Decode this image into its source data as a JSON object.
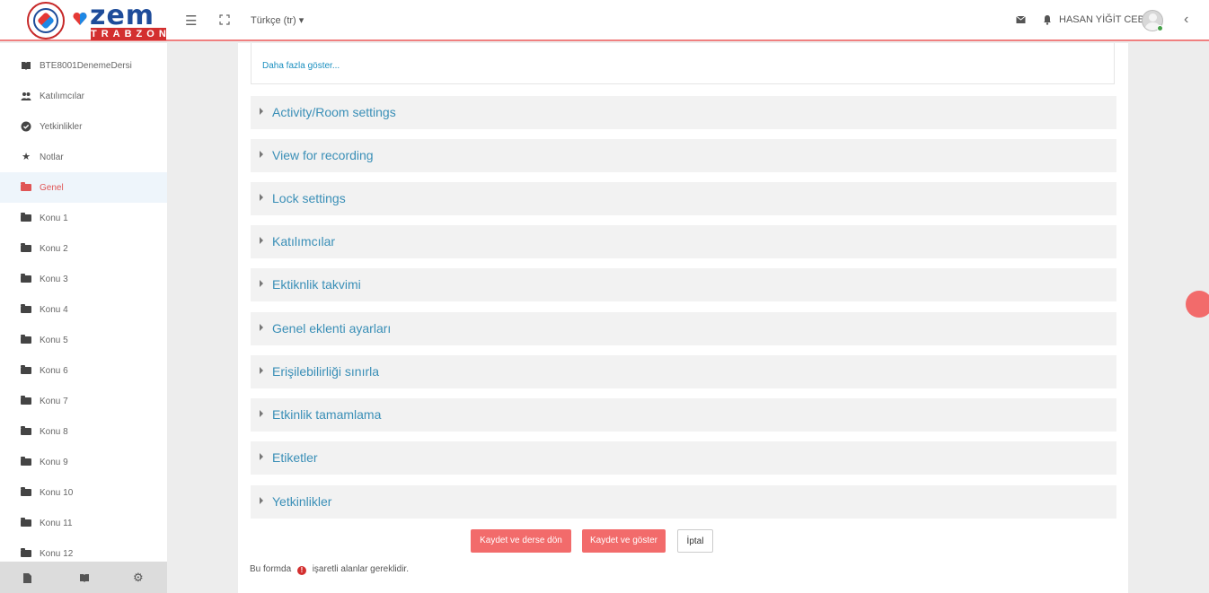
{
  "header": {
    "logo_word": "zem",
    "logo_sub": "TRABZON",
    "language": "Türkçe (tr) ▾",
    "user_name": "HASAN YİĞİT CEBECİ"
  },
  "sidebar": {
    "items": [
      {
        "label": "BTE8001DenemeDersi",
        "icon": "course-icon"
      },
      {
        "label": "Katılımcılar",
        "icon": "users-icon"
      },
      {
        "label": "Yetkinlikler",
        "icon": "check-circle-icon"
      },
      {
        "label": "Notlar",
        "icon": "star-icon"
      },
      {
        "label": "Genel",
        "icon": "folder-icon"
      },
      {
        "label": "Konu 1",
        "icon": "folder-icon"
      },
      {
        "label": "Konu 2",
        "icon": "folder-icon"
      },
      {
        "label": "Konu 3",
        "icon": "folder-icon"
      },
      {
        "label": "Konu 4",
        "icon": "folder-icon"
      },
      {
        "label": "Konu 5",
        "icon": "folder-icon"
      },
      {
        "label": "Konu 6",
        "icon": "folder-icon"
      },
      {
        "label": "Konu 7",
        "icon": "folder-icon"
      },
      {
        "label": "Konu 8",
        "icon": "folder-icon"
      },
      {
        "label": "Konu 9",
        "icon": "folder-icon"
      },
      {
        "label": "Konu 10",
        "icon": "folder-icon"
      },
      {
        "label": "Konu 11",
        "icon": "folder-icon"
      },
      {
        "label": "Konu 12",
        "icon": "folder-icon"
      }
    ],
    "active_label": "Genel"
  },
  "main": {
    "show_more": "Daha fazla göster...",
    "sections": [
      "Activity/Room settings",
      "View for recording",
      "Lock settings",
      "Katılımcılar",
      "Ektiknlik takvimi",
      "Genel eklenti ayarları",
      "Erişilebilirliği sınırla",
      "Etkinlik tamamlama",
      "Etiketler",
      "Yetkinlikler"
    ],
    "buttons": {
      "save_return": "Kaydet ve derse dön",
      "save_display": "Kaydet ve göster",
      "cancel": "İptal"
    },
    "required_note_prefix": "Bu formda",
    "required_note_suffix": "işaretli alanlar gereklidir."
  },
  "colors": {
    "accent": "#f26b6b",
    "link": "#3a8fb7",
    "active_bg": "#eef5fb"
  }
}
